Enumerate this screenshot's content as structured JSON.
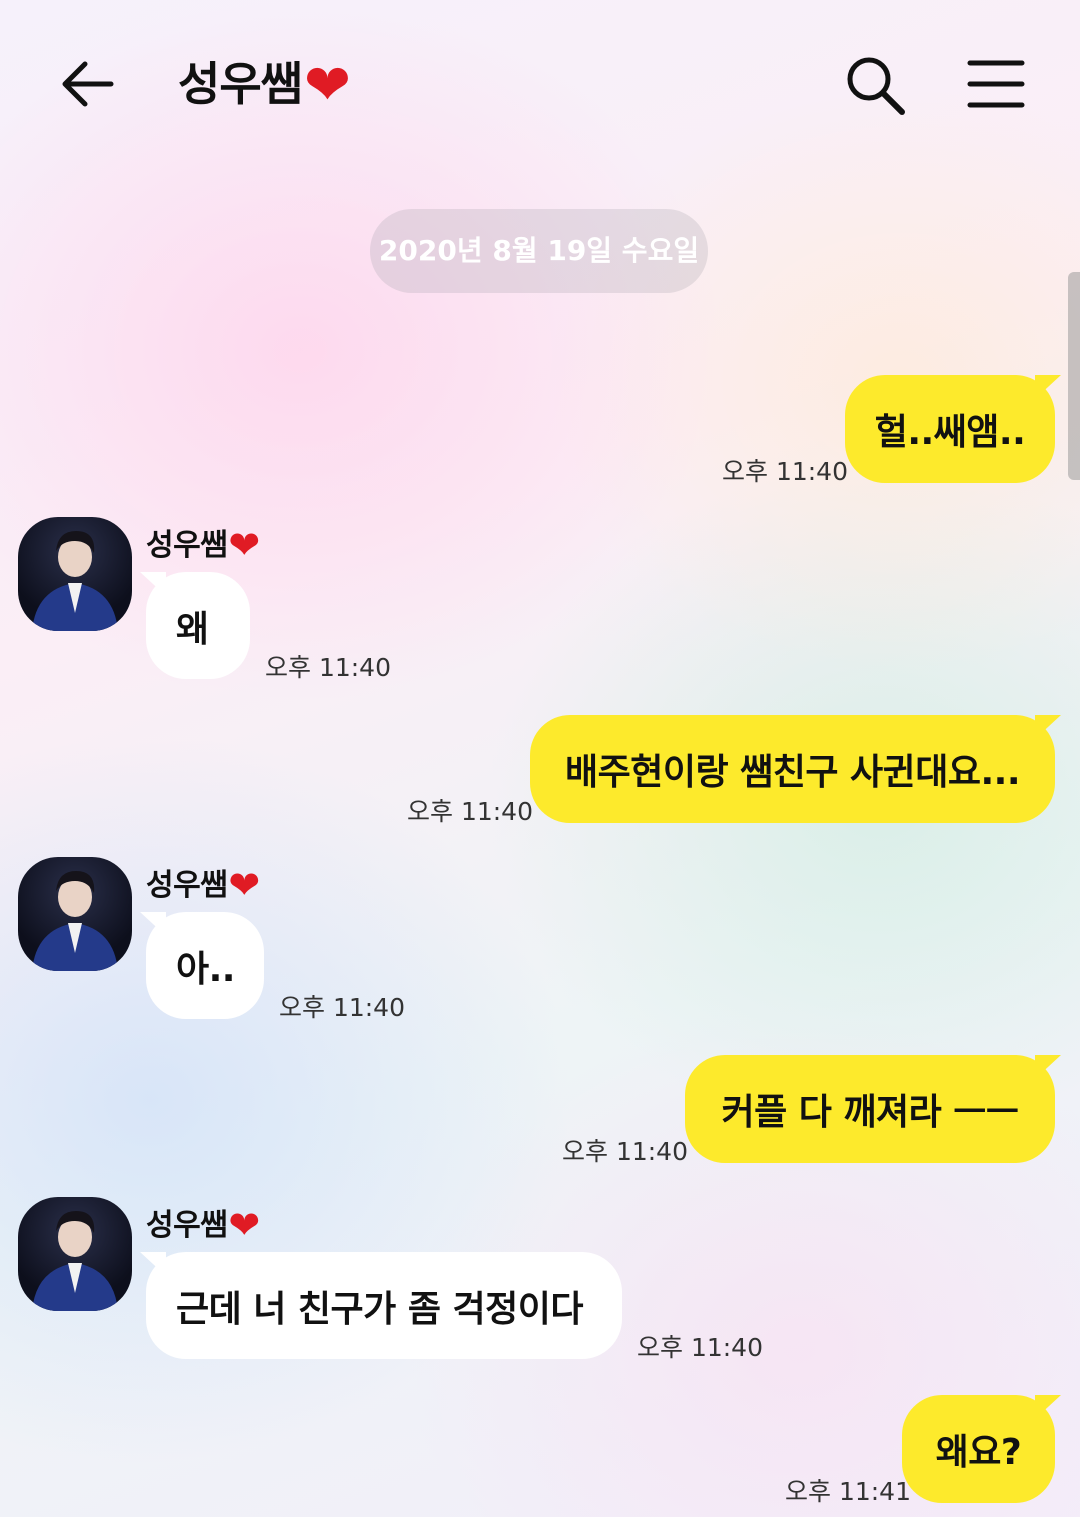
{
  "header": {
    "title": "성우쌤",
    "title_emoji": "❤",
    "back_icon": "arrow-left-icon",
    "search_icon": "search-icon",
    "menu_icon": "hamburger-menu-icon"
  },
  "chat": {
    "date": "2020년 8월 19일 수요일",
    "contact_name": "성우쌤",
    "contact_emoji": "❤",
    "messages": [
      {
        "from": "me",
        "text": "헐..쌔앰..",
        "time": "오후 11:40"
      },
      {
        "from": "them",
        "text": "왜",
        "time": "오후 11:40"
      },
      {
        "from": "me",
        "text": "배주현이랑 쌤친구 사귄대요...",
        "time": "오후 11:40"
      },
      {
        "from": "them",
        "text": "아..",
        "time": "오후 11:40"
      },
      {
        "from": "me",
        "text": "커플 다 깨져라 ㅡㅡ",
        "time": "오후 11:40"
      },
      {
        "from": "them",
        "text": "근데 너 친구가 좀 걱정이다",
        "time": "오후 11:40"
      },
      {
        "from": "me",
        "text": "왜요?",
        "time": "오후 11:41"
      }
    ]
  },
  "colors": {
    "my_bubble": "#fdea2c",
    "their_bubble": "#ffffff",
    "heart": "#e01b24"
  }
}
